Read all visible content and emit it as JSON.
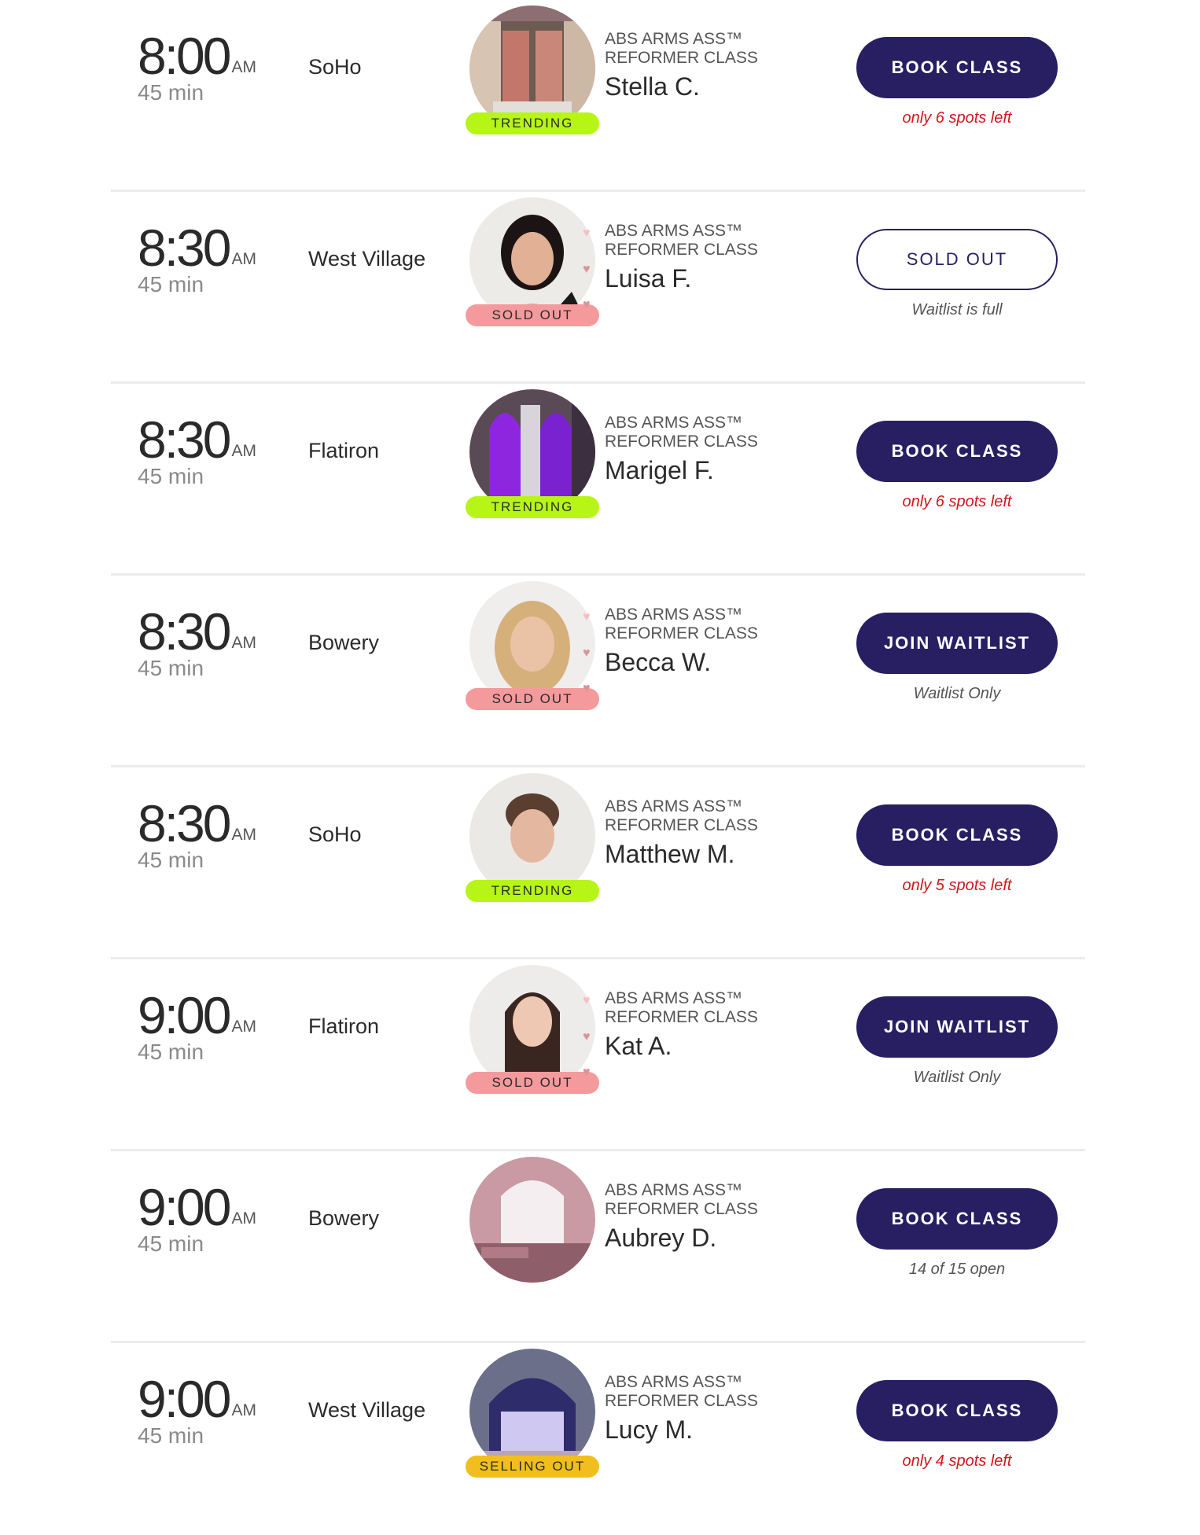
{
  "colors": {
    "button_primary": "#271f62",
    "trending": "#b6f516",
    "sold_out": "#f59a9c",
    "selling_out": "#f2be1d",
    "urgent_note": "#d0161c"
  },
  "classes": [
    {
      "time": "8:00",
      "ampm": "AM",
      "duration": "45 min",
      "location": "SoHo",
      "class_name": "ABS ARMS ASS™ REFORMER CLASS",
      "instructor": "Stella C.",
      "badge": "TRENDING",
      "badge_type": "trending",
      "avatar": "studio-window",
      "button": "BOOK CLASS",
      "button_style": "primary",
      "note": "only 6 spots left",
      "note_style": "urgent"
    },
    {
      "time": "8:30",
      "ampm": "AM",
      "duration": "45 min",
      "location": "West Village",
      "class_name": "ABS ARMS ASS™ REFORMER CLASS",
      "instructor": "Luisa F.",
      "badge": "SOLD OUT",
      "badge_type": "soldout",
      "avatar": "instructor-dark-hair",
      "button": "SOLD OUT",
      "button_style": "outline",
      "note": "Waitlist is full",
      "note_style": "muted"
    },
    {
      "time": "8:30",
      "ampm": "AM",
      "duration": "45 min",
      "location": "Flatiron",
      "class_name": "ABS ARMS ASS™ REFORMER CLASS",
      "instructor": "Marigel F.",
      "badge": "TRENDING",
      "badge_type": "trending",
      "avatar": "purple-windows",
      "button": "BOOK CLASS",
      "button_style": "primary",
      "note": "only 6 spots left",
      "note_style": "urgent"
    },
    {
      "time": "8:30",
      "ampm": "AM",
      "duration": "45 min",
      "location": "Bowery",
      "class_name": "ABS ARMS ASS™ REFORMER CLASS",
      "instructor": "Becca W.",
      "badge": "SOLD OUT",
      "badge_type": "soldout",
      "avatar": "instructor-blonde",
      "button": "JOIN WAITLIST",
      "button_style": "primary",
      "note": "Waitlist Only",
      "note_style": "muted"
    },
    {
      "time": "8:30",
      "ampm": "AM",
      "duration": "45 min",
      "location": "SoHo",
      "class_name": "ABS ARMS ASS™ REFORMER CLASS",
      "instructor": "Matthew M.",
      "badge": "TRENDING",
      "badge_type": "trending",
      "avatar": "instructor-male",
      "button": "BOOK CLASS",
      "button_style": "primary",
      "note": "only 5 spots left",
      "note_style": "urgent"
    },
    {
      "time": "9:00",
      "ampm": "AM",
      "duration": "45 min",
      "location": "Flatiron",
      "class_name": "ABS ARMS ASS™ REFORMER CLASS",
      "instructor": "Kat A.",
      "badge": "SOLD OUT",
      "badge_type": "soldout",
      "avatar": "instructor-long-hair",
      "button": "JOIN WAITLIST",
      "button_style": "primary",
      "note": "Waitlist Only",
      "note_style": "muted"
    },
    {
      "time": "9:00",
      "ampm": "AM",
      "duration": "45 min",
      "location": "Bowery",
      "class_name": "ABS ARMS ASS™ REFORMER CLASS",
      "instructor": "Aubrey D.",
      "badge": "",
      "badge_type": "none",
      "avatar": "pink-studio",
      "button": "BOOK CLASS",
      "button_style": "primary",
      "note": "14 of 15 open",
      "note_style": "muted"
    },
    {
      "time": "9:00",
      "ampm": "AM",
      "duration": "45 min",
      "location": "West Village",
      "class_name": "ABS ARMS ASS™ REFORMER CLASS",
      "instructor": "Lucy M.",
      "badge": "SELLING OUT",
      "badge_type": "selling",
      "avatar": "arched-window",
      "button": "BOOK CLASS",
      "button_style": "primary",
      "note": "only 4 spots left",
      "note_style": "urgent"
    }
  ]
}
